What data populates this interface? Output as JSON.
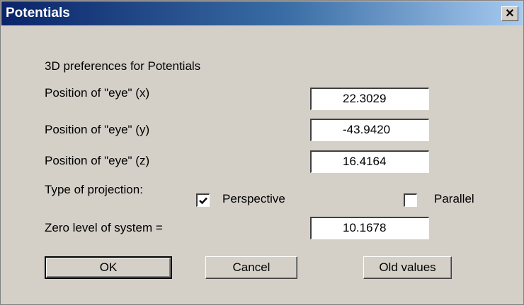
{
  "window": {
    "title": "Potentials",
    "close_glyph": "✕"
  },
  "heading": "3D preferences for Potentials",
  "fields": [
    {
      "label": "Position of \"eye\" (x)",
      "value": "22.3029"
    },
    {
      "label": "Position of \"eye\" (y)",
      "value": "-43.9420"
    },
    {
      "label": "Position of \"eye\" (z)",
      "value": "16.4164"
    }
  ],
  "projection": {
    "label": "Type of projection:",
    "perspective": {
      "label": "Perspective",
      "checked": true
    },
    "parallel": {
      "label": "Parallel",
      "checked": false
    }
  },
  "zero_level": {
    "label": "Zero level of system =",
    "value": "10.1678"
  },
  "buttons": {
    "ok": "OK",
    "cancel": "Cancel",
    "old_values": "Old values"
  }
}
